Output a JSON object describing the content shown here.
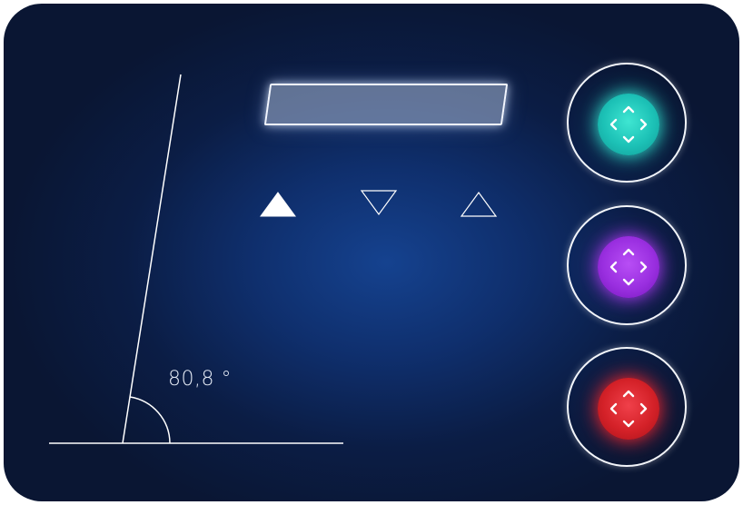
{
  "angle": {
    "value": 80.8,
    "readout": "80,8 °"
  },
  "display": {
    "text": ""
  },
  "triangle_buttons": [
    {
      "name": "triangle-up-filled",
      "direction": "up",
      "filled": true
    },
    {
      "name": "triangle-down-outline",
      "direction": "down",
      "filled": false
    },
    {
      "name": "triangle-up-outline",
      "direction": "up",
      "filled": false
    }
  ],
  "controls": [
    {
      "name": "teal-direction-button",
      "icon": "four-way-arrows-icon",
      "color": "#22c9bb"
    },
    {
      "name": "purple-direction-button",
      "icon": "four-way-arrows-icon",
      "color": "#a033e6"
    },
    {
      "name": "red-direction-button",
      "icon": "four-way-arrows-icon",
      "color": "#d9232b"
    }
  ],
  "colors": {
    "background_center": "#15428f",
    "background_edge": "#0a1633",
    "line": "#ffffff"
  }
}
